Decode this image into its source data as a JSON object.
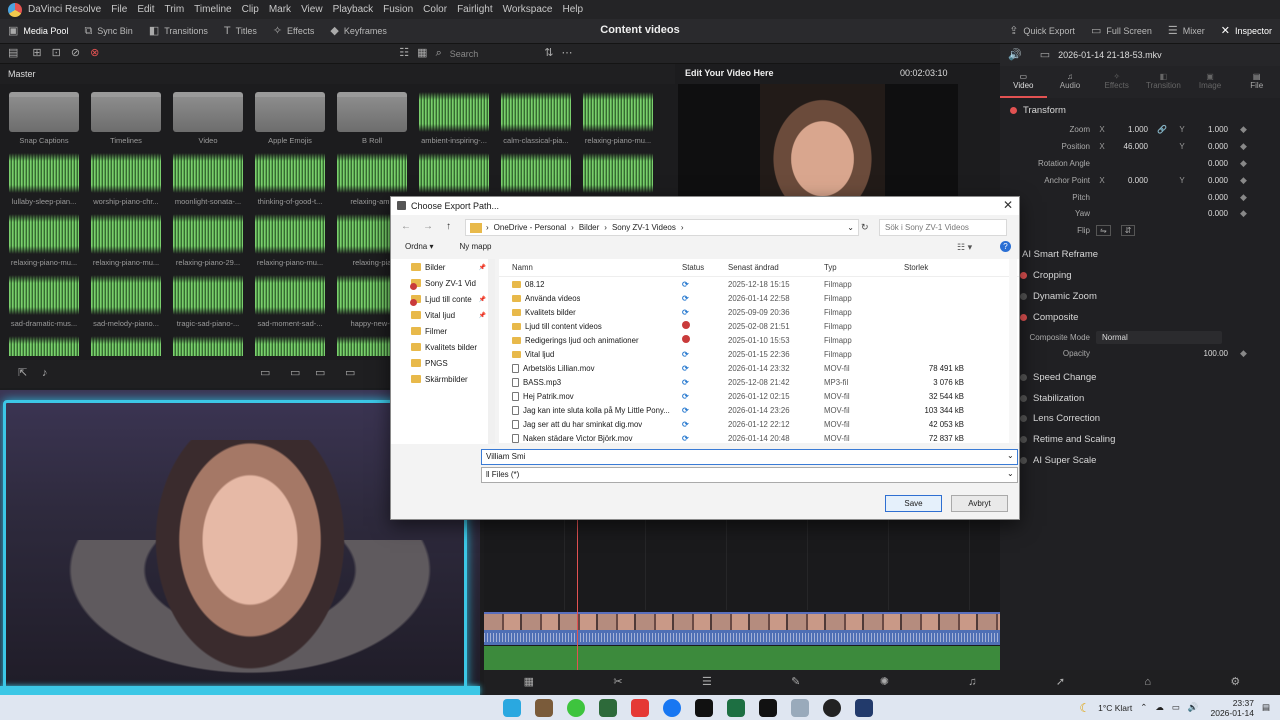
{
  "menubar": {
    "app": "DaVinci Resolve",
    "items": [
      "File",
      "Edit",
      "Trim",
      "Timeline",
      "Clip",
      "Mark",
      "View",
      "Playback",
      "Fusion",
      "Color",
      "Fairlight",
      "Workspace",
      "Help"
    ]
  },
  "toolbar": {
    "left": [
      "Media Pool",
      "Sync Bin",
      "Transitions",
      "Titles",
      "Effects",
      "Keyframes"
    ],
    "center_title": "Content videos",
    "right": [
      "Quick Export",
      "Full Screen",
      "Mixer",
      "Inspector"
    ]
  },
  "media_pool": {
    "search_placeholder": "Search",
    "master": "Master",
    "clips": [
      {
        "label": "Snap Captions",
        "kind": "folder"
      },
      {
        "label": "Timelines",
        "kind": "folder"
      },
      {
        "label": "Video",
        "kind": "folder"
      },
      {
        "label": "Apple Emojis",
        "kind": "folder"
      },
      {
        "label": "B Roll",
        "kind": "folder"
      },
      {
        "label": "ambient-inspiring-...",
        "kind": "wave"
      },
      {
        "label": "calm-classical-pia...",
        "kind": "wave"
      },
      {
        "label": "relaxing-piano-mu...",
        "kind": "wave"
      },
      {
        "label": "lullaby-sleep-pian...",
        "kind": "wave"
      },
      {
        "label": "worship-piano-chr...",
        "kind": "wave"
      },
      {
        "label": "moonlight-sonata-...",
        "kind": "wave"
      },
      {
        "label": "thinking-of-good-t...",
        "kind": "wave"
      },
      {
        "label": "relaxing-amb",
        "kind": "wave"
      },
      {
        "label": "",
        "kind": "wave",
        "selected": true
      },
      {
        "label": "",
        "kind": "wave"
      },
      {
        "label": "",
        "kind": "wave"
      },
      {
        "label": "relaxing-piano-mu...",
        "kind": "wave"
      },
      {
        "label": "relaxing-piano-mu...",
        "kind": "wave"
      },
      {
        "label": "relaxing-piano-29...",
        "kind": "wave"
      },
      {
        "label": "relaxing-piano-mu...",
        "kind": "wave"
      },
      {
        "label": "relaxing-pia",
        "kind": "wave"
      },
      {
        "label": "",
        "kind": "wave"
      },
      {
        "label": "",
        "kind": "wave"
      },
      {
        "label": "",
        "kind": "wave"
      },
      {
        "label": "sad-dramatic-mus...",
        "kind": "wave"
      },
      {
        "label": "sad-melody-piano...",
        "kind": "wave"
      },
      {
        "label": "tragic-sad-piano-...",
        "kind": "wave"
      },
      {
        "label": "sad-moment-sad-...",
        "kind": "wave"
      },
      {
        "label": "happy-new-y",
        "kind": "wave"
      }
    ]
  },
  "viewer": {
    "title": "Edit Your Video Here",
    "timecode": "00:02:03:10"
  },
  "inspector": {
    "file": "2026-01-14 21-18-53.mkv",
    "tabs": [
      "Video",
      "Audio",
      "Effects",
      "Transition",
      "Image",
      "File"
    ],
    "transform": "Transform",
    "rows": [
      {
        "name": "Zoom",
        "x": "1.000",
        "y": "1.000"
      },
      {
        "name": "Position",
        "x": "46.000",
        "y": "0.000"
      },
      {
        "name": "Rotation Angle",
        "v": "0.000"
      },
      {
        "name": "Anchor Point",
        "x": "0.000",
        "y": "0.000"
      },
      {
        "name": "Pitch",
        "v": "0.000"
      },
      {
        "name": "Yaw",
        "v": "0.000"
      },
      {
        "name": "Flip"
      }
    ],
    "smart_reframe": "AI Smart Reframe",
    "cropping": "Cropping",
    "dynamic_zoom": "Dynamic Zoom",
    "composite": "Composite",
    "composite_mode_label": "Composite Mode",
    "composite_mode": "Normal",
    "opacity_label": "Opacity",
    "opacity": "100.00",
    "sections": [
      "Speed Change",
      "Stabilization",
      "Lens Correction",
      "Retime and Scaling",
      "AI Super Scale"
    ]
  },
  "dialog": {
    "title": "Choose Export Path...",
    "path": [
      "OneDrive - Personal",
      "Bilder",
      "Sony ZV-1 Videos"
    ],
    "search_placeholder": "Sök i Sony ZV-1 Videos",
    "organize": "Ordna",
    "new_folder": "Ny mapp",
    "nav": [
      {
        "label": "Bilder",
        "pin": true
      },
      {
        "label": "Sony ZV-1 Vid",
        "err": true
      },
      {
        "label": "Ljud till conte",
        "err": true,
        "pin": true
      },
      {
        "label": "Vital ljud",
        "pin": true
      },
      {
        "label": "Filmer"
      },
      {
        "label": "Kvalitets bilder"
      },
      {
        "label": "PNGS"
      },
      {
        "label": "Skärmbilder"
      }
    ],
    "columns": {
      "name": "Namn",
      "status": "Status",
      "date": "Senast ändrad",
      "type": "Typ",
      "size": "Storlek"
    },
    "files": [
      {
        "name": "08.12",
        "status": "sync",
        "date": "2025-12-18 15:15",
        "type": "Filmapp",
        "size": "",
        "folder": true
      },
      {
        "name": "Använda videos",
        "status": "sync",
        "date": "2026-01-14 22:58",
        "type": "Filmapp",
        "size": "",
        "folder": true
      },
      {
        "name": "Kvalitets bilder",
        "status": "sync",
        "date": "2025-09-09 20:36",
        "type": "Filmapp",
        "size": "",
        "folder": true
      },
      {
        "name": "Ljud till content videos",
        "status": "err",
        "date": "2025-02-08 21:51",
        "type": "Filmapp",
        "size": "",
        "folder": true
      },
      {
        "name": "Redigerings ljud och animationer",
        "status": "err",
        "date": "2025-01-10 15:53",
        "type": "Filmapp",
        "size": "",
        "folder": true
      },
      {
        "name": "Vital ljud",
        "status": "sync",
        "date": "2025-01-15 22:36",
        "type": "Filmapp",
        "size": "",
        "folder": true
      },
      {
        "name": "Arbetslös Lillian.mov",
        "status": "sync",
        "date": "2026-01-14 23:32",
        "type": "MOV-fil",
        "size": "78 491 kB",
        "folder": false
      },
      {
        "name": "BASS.mp3",
        "status": "sync",
        "date": "2025-12-08 21:42",
        "type": "MP3-fil",
        "size": "3 076 kB",
        "folder": false
      },
      {
        "name": "Hej Patrik.mov",
        "status": "sync",
        "date": "2026-01-12 02:15",
        "type": "MOV-fil",
        "size": "32 544 kB",
        "folder": false
      },
      {
        "name": "Jag kan inte sluta kolla på My Little Pony...",
        "status": "sync",
        "date": "2026-01-14 23:26",
        "type": "MOV-fil",
        "size": "103 344 kB",
        "folder": false
      },
      {
        "name": "Jag ser att du har sminkat dig.mov",
        "status": "sync",
        "date": "2026-01-12 22:12",
        "type": "MOV-fil",
        "size": "42 053 kB",
        "folder": false
      },
      {
        "name": "Naken städare Victor Björk.mov",
        "status": "sync",
        "date": "2026-01-14 20:48",
        "type": "MOV-fil",
        "size": "72 837 kB",
        "folder": false
      }
    ],
    "filename": "Villiam Smi",
    "filetype": "ll Files (*)",
    "save": "Save",
    "cancel": "Avbryt"
  },
  "taskbar": {
    "weather": "1°C  Klart",
    "time": "23:37",
    "date": "2026-01-14"
  }
}
